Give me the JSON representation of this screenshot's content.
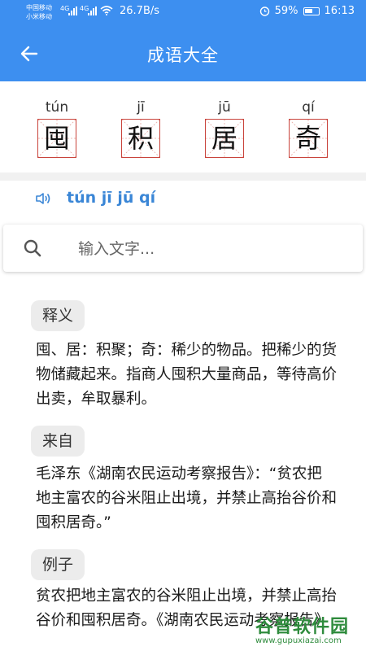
{
  "status_bar": {
    "carrier_1": "中国移动",
    "carrier_2": "小米移动",
    "network_1": "4G",
    "network_2": "4G",
    "speed": "26.7B/s",
    "battery": "59%",
    "time": "16:13"
  },
  "header": {
    "title": "成语大全"
  },
  "idiom": {
    "characters": [
      {
        "pinyin": "tún",
        "char": "囤"
      },
      {
        "pinyin": "jī",
        "char": "积"
      },
      {
        "pinyin": "jū",
        "char": "居"
      },
      {
        "pinyin": "qí",
        "char": "奇"
      }
    ],
    "pinyin_full": "tún jī jū qí"
  },
  "search": {
    "placeholder": "输入文字..."
  },
  "sections": [
    {
      "label": "释义",
      "text": "囤、居：积聚；奇：稀少的物品。把稀少的货物储藏起来。指商人囤积大量商品，等待高价出卖，牟取暴利。"
    },
    {
      "label": "来自",
      "text": "毛泽东《湖南农民运动考察报告》：“贫农把地主富农的谷米阻止出境，并禁止高抬谷价和囤积居奇。”"
    },
    {
      "label": "例子",
      "text": "贫农把地主富农的谷米阻止出境，并禁止高抬谷价和囤积居奇。《湖南农民运动考察报告》"
    }
  ],
  "watermark": {
    "name": "谷普软件园",
    "url": "www.gupuxiazai.com"
  },
  "colors": {
    "primary": "#3d8ff0",
    "pinyin_blue": "#3a86d6",
    "grid_red": "#c9433b"
  }
}
